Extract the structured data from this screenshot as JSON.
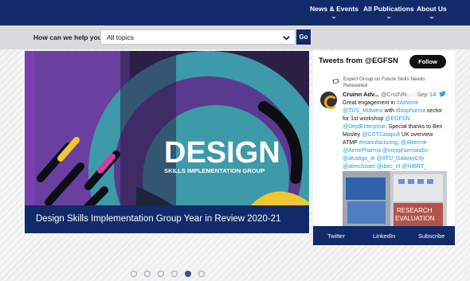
{
  "nav": {
    "items": [
      {
        "label": "News & Events"
      },
      {
        "label": "All Publications"
      },
      {
        "label": "About Us"
      }
    ]
  },
  "search": {
    "label": "How can we help you?",
    "topic_value": "All topics",
    "go_label": "Go"
  },
  "slide": {
    "headline": "DESIGN",
    "subheadline": "SKILLS IMPLEMENTATION GROUP",
    "caption": "Design Skills Implementation Group Year in Review 2020-21"
  },
  "carousel": {
    "count": 6,
    "active_index": 4
  },
  "tweets": {
    "title": "Tweets from @EGFSN",
    "follow_label": "Follow",
    "retweet_text": "Expert Group on Future Skills Needs Retweeted",
    "name": "Cruinn Adv...",
    "handle": "@CruINN...",
    "date": "· Sep 14",
    "body": [
      {
        "t": "Great engagement in ",
        "h": false
      },
      {
        "t": "#Athlone",
        "h": true
      },
      {
        "t": " ",
        "h": false
      },
      {
        "t": "@TUS_Midwest",
        "h": true
      },
      {
        "t": " with ",
        "h": false
      },
      {
        "t": "#biopharma",
        "h": true
      },
      {
        "t": " sector for 1st workshop ",
        "h": false
      },
      {
        "t": "@EGFSN",
        "h": true
      },
      {
        "t": " ",
        "h": false
      },
      {
        "t": "@DeptEnterprise",
        "h": true
      },
      {
        "t": ". Special thanks to Ben Mosley ",
        "h": false
      },
      {
        "t": "@CGTCatapult",
        "h": true
      },
      {
        "t": " UK overview ATMP ",
        "h": false
      },
      {
        "t": "#manufacturing",
        "h": true
      },
      {
        "t": ", ",
        "h": false
      },
      {
        "t": "@Alkerme",
        "h": true
      },
      {
        "t": " ",
        "h": false
      },
      {
        "t": "@AeriePharma",
        "h": true
      },
      {
        "t": " ",
        "h": false
      },
      {
        "t": "@innopharmalabs",
        "h": true
      },
      {
        "t": " ",
        "h": false
      },
      {
        "t": "@atusligo_ie",
        "h": true
      },
      {
        "t": " ",
        "h": false
      },
      {
        "t": "@ATU_GalwayCity",
        "h": true
      },
      {
        "t": " ",
        "h": false
      },
      {
        "t": "@atimcluster",
        "h": true
      },
      {
        "t": " ",
        "h": false
      },
      {
        "t": "@ibec_irl",
        "h": true
      },
      {
        "t": " ",
        "h": false
      },
      {
        "t": "@NIBRT_",
        "h": true
      }
    ],
    "media_text_1": "RESEARCH",
    "media_text_2": "EVALUATION"
  },
  "social": {
    "twitter": "Twitter",
    "linkedin": "LinkedIn",
    "subscribe": "Subscribe"
  },
  "colors": {
    "navy": "#132a6a",
    "twitter_blue": "#1d9bf0",
    "slide_purple": "#6b3fa0",
    "slide_teal": "#3d9aa8",
    "slide_yellow": "#f2c832",
    "slide_dark": "#2c1f45"
  }
}
